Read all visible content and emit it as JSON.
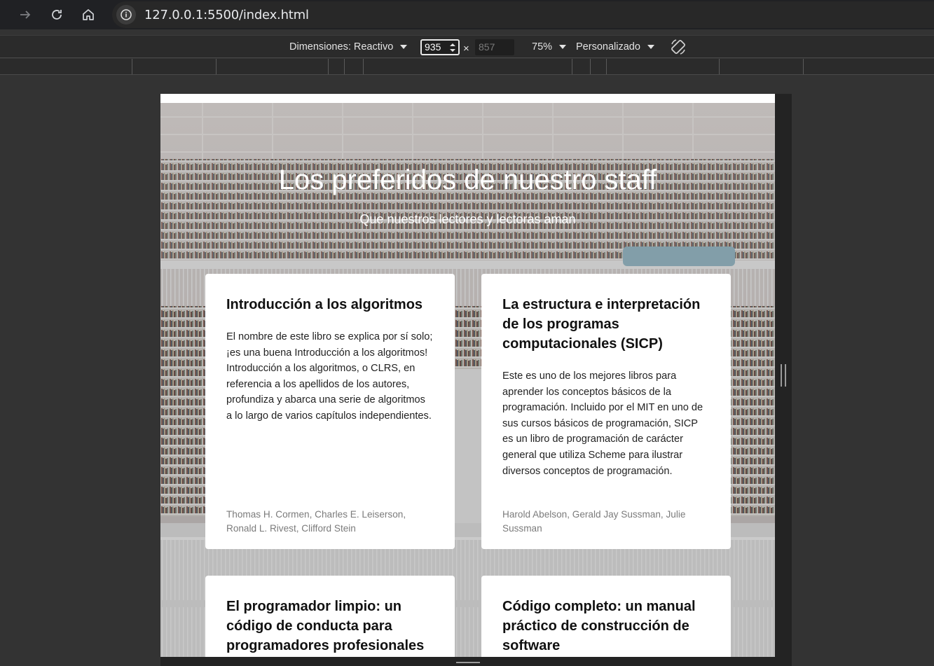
{
  "browser": {
    "url": "127.0.0.1:5500/index.html",
    "icons": [
      "forward-arrow-icon",
      "reload-icon",
      "home-icon",
      "info-icon"
    ]
  },
  "devtools": {
    "dimensions_label": "Dimensiones: Reactivo",
    "width_value": "935",
    "height_value": "857",
    "times_symbol": "×",
    "zoom_label": "75%",
    "throttle_label": "Personalizado"
  },
  "page": {
    "title": "Los preferidos de nuestro staff",
    "subtitle": "Que nuestros lectores y lectoras aman",
    "cards": [
      {
        "title": "Introducción a los algoritmos",
        "description": "El nombre de este libro se explica por sí solo; ¡es una buena Introducción a los algoritmos! Introducción a los algoritmos, o CLRS, en referencia a los apellidos de los autores, profundiza y abarca una serie de algoritmos a lo largo de varios capítulos independientes.",
        "authors": "Thomas H. Cormen, Charles E. Leiserson, Ronald L. Rivest, Clifford Stein"
      },
      {
        "title": "La estructura e interpretación de los programas computacionales (SICP)",
        "description": "Este es uno de los mejores libros para aprender los conceptos básicos de la programación. Incluido por el MIT en uno de sus cursos básicos de programación, SICP es un libro de programación de carácter general que utiliza Scheme para ilustrar diversos conceptos de programación.",
        "authors": "Harold Abelson, Gerald Jay Sussman, Julie Sussman"
      },
      {
        "title": "El programador limpio: un código de conducta para programadores profesionales"
      },
      {
        "title": "Código completo: un manual práctico de construcción de software"
      }
    ]
  },
  "colors": {
    "browser_bg": "#202124",
    "devtools_bg": "#2b2b2b",
    "outer_bg": "#333333",
    "card_bg": "#ffffff",
    "hero_text": "#ffffff"
  }
}
